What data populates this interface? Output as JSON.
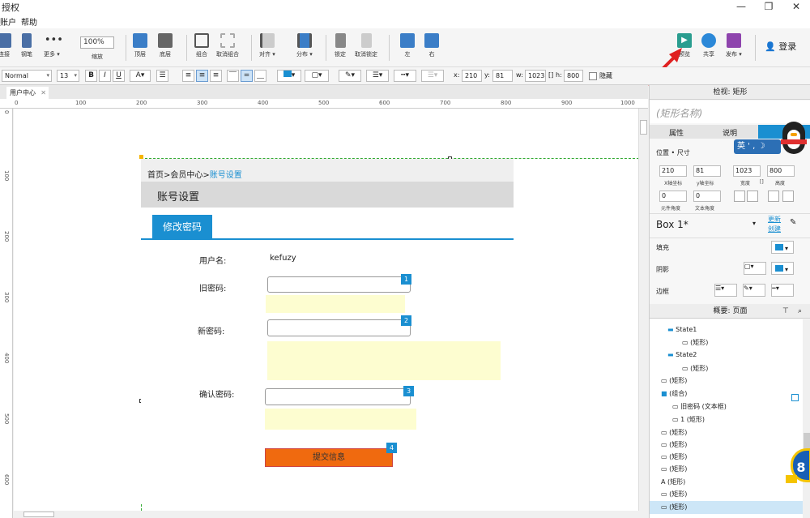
{
  "window": {
    "title": "授权",
    "min": "—",
    "restore": "❐",
    "close": "✕"
  },
  "menu": [
    "账户",
    "帮助"
  ],
  "toolbar": {
    "items": [
      {
        "label": "连接",
        "color": "#4a6fa5"
      },
      {
        "label": "钢笔",
        "color": "#4a6fa5"
      },
      {
        "label": "更多 ▾",
        "color": "#777"
      },
      {
        "label": "缩放",
        "color": "#fff"
      },
      {
        "label": "顶层",
        "color": "#3b7ec7"
      },
      {
        "label": "底层",
        "color": "#666"
      },
      {
        "label": "组合",
        "color": "#555"
      },
      {
        "label": "取消组合",
        "color": "#aaa"
      },
      {
        "label": "对齐 ▾",
        "color": "#555"
      },
      {
        "label": "分布 ▾",
        "color": "#555"
      },
      {
        "label": "锁定",
        "color": "#888"
      },
      {
        "label": "取消锁定",
        "color": "#bbb"
      },
      {
        "label": "左",
        "color": "#3b7ec7"
      },
      {
        "label": "右",
        "color": "#3b7ec7"
      },
      {
        "label": "预览",
        "color": "#2a9d8f"
      },
      {
        "label": "共享",
        "color": "#2b88d8"
      },
      {
        "label": "发布 ▾",
        "color": "#8e44ad"
      }
    ],
    "zoom": "100%",
    "login": "登录"
  },
  "format": {
    "style": "Normal",
    "font_size": "13",
    "bold": "B",
    "italic": "I",
    "underline": "U",
    "x_label": "x:",
    "x": "210",
    "y_label": "y:",
    "y": "81",
    "w_label": "w:",
    "w": "1023",
    "h_label": "h:",
    "h": "800",
    "hide_label": "隐藏"
  },
  "tab": {
    "label": "用户中心"
  },
  "ruler_h": [
    "0",
    "100",
    "200",
    "300",
    "400",
    "500",
    "600",
    "700",
    "800",
    "900",
    "1000"
  ],
  "ruler_v": [
    "0",
    "100",
    "200",
    "300",
    "400",
    "500",
    "600"
  ],
  "page": {
    "breadcrumb_prefix": "首页>会员中心>",
    "breadcrumb_current": "账号设置",
    "section_title": "账号设置",
    "tab_label": "修改密码",
    "username_label": "用户名:",
    "username_value": "kefuzy",
    "old_pwd_label": "旧密码:",
    "new_pwd_label": "新密码:",
    "confirm_pwd_label": "确认密码:",
    "submit_label": "提交信息",
    "badges": [
      "1",
      "2",
      "3",
      "4"
    ]
  },
  "inspector": {
    "title": "检视: 矩形",
    "shape_name_placeholder": "(矩形名称)",
    "tabs": [
      "属性",
      "说明"
    ],
    "section": "位置 • 尺寸",
    "x": "210",
    "y": "81",
    "w": "1023",
    "h": "800",
    "x_caption": "X轴坐标",
    "y_caption": "y轴坐标",
    "w_caption": "宽度",
    "h_caption": "高度",
    "rot": "0",
    "text_rot": "0",
    "rot_caption": "元件角度",
    "text_rot_caption": "文本角度",
    "style_name": "Box 1*",
    "update": "更新",
    "create": "创建",
    "fill": "填充",
    "shadow": "阴影",
    "border": "边框",
    "ime": "英 ' , ☽"
  },
  "outline": {
    "title": "概要: 页面",
    "items": [
      {
        "text": "State1",
        "indent": 1
      },
      {
        "text": "(矩形)",
        "indent": 2
      },
      {
        "text": "State2",
        "indent": 1
      },
      {
        "text": "(矩形)",
        "indent": 2
      },
      {
        "text": "(矩形)",
        "indent": 0
      },
      {
        "text": "(组合)",
        "indent": 0
      },
      {
        "text": "旧密码 (文本框)",
        "indent": 1
      },
      {
        "text": "1 (矩形)",
        "indent": 1
      },
      {
        "text": "(矩形)",
        "indent": 0
      },
      {
        "text": "(矩形)",
        "indent": 0
      },
      {
        "text": "(矩形)",
        "indent": 0
      },
      {
        "text": "(矩形)",
        "indent": 0
      },
      {
        "text": "(矩形)",
        "indent": 0
      },
      {
        "text": "(矩形)",
        "indent": 0
      },
      {
        "text": "(矩形)",
        "indent": 0
      }
    ],
    "float_badge": "8"
  },
  "colors": {
    "accent": "#1a8fd1",
    "orange": "#f06a0f",
    "arrow": "#e02020",
    "yellow": "#fdfdd0"
  }
}
